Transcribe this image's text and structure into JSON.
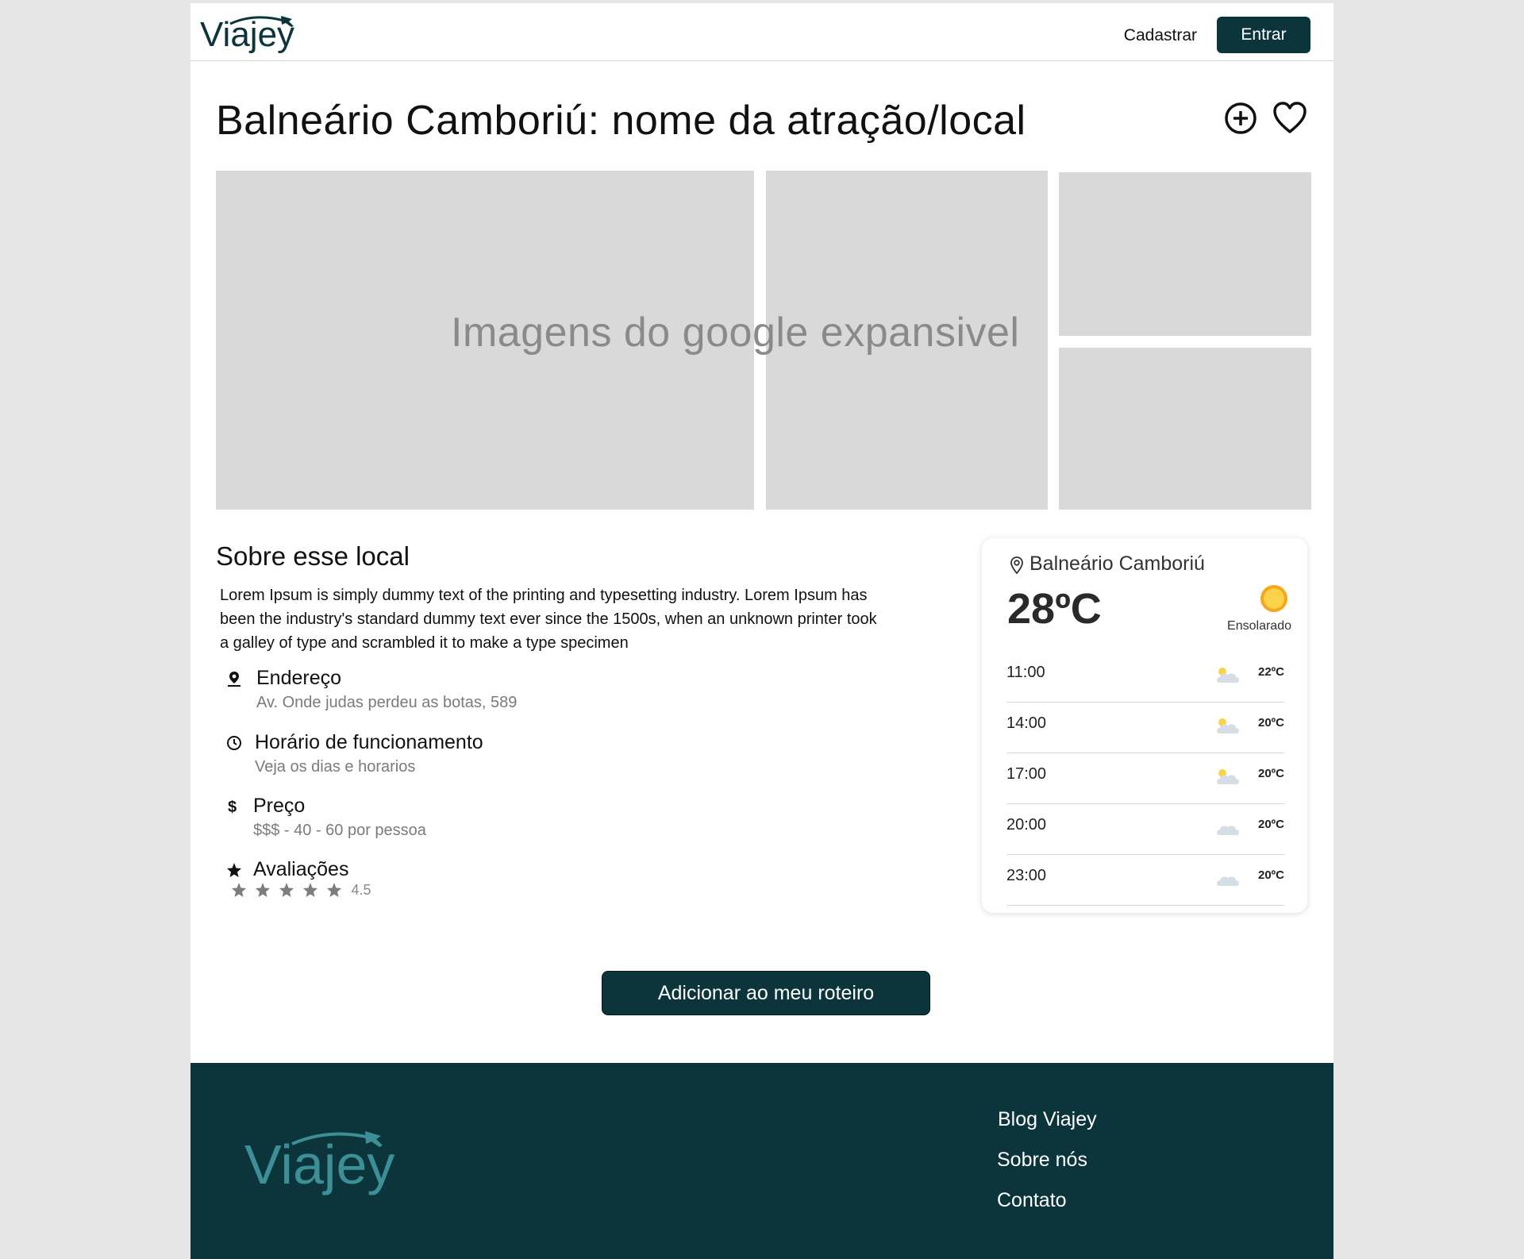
{
  "header": {
    "logo_text": "Viajey",
    "signup_label": "Cadastrar",
    "login_label": "Entrar"
  },
  "page": {
    "title": "Balneário Camboriú: nome da atração/local"
  },
  "gallery": {
    "label": "Imagens do google expansivel"
  },
  "about": {
    "title": "Sobre esse local",
    "text": "Lorem Ipsum is simply dummy text of the printing and  typesetting industry. Lorem Ipsum has been the industry's standard dummy text ever since the 1500s, when an unknown printer took a galley of  type and scrambled it to make a type specimen",
    "items": [
      {
        "icon": "map-pin-icon",
        "label": "Endereço",
        "sub": "Av. Onde judas perdeu as botas, 589"
      },
      {
        "icon": "clock-icon",
        "label": "Horário de funcionamento",
        "sub": "Veja os dias e horarios"
      },
      {
        "icon": "dollar-icon",
        "label": "Preço",
        "sub": "$$$ - 40 - 60 por pessoa"
      },
      {
        "icon": "star-icon",
        "label": "Avaliações",
        "rating": "4.5",
        "stars": 5
      }
    ]
  },
  "weather": {
    "location": "Balneário Camboriú",
    "temperature": "28ºC",
    "condition": "Ensolarado",
    "forecast": [
      {
        "time": "11:00",
        "temp": "22ºC",
        "icon": "partly-cloudy-icon"
      },
      {
        "time": "14:00",
        "temp": "20ºC",
        "icon": "partly-cloudy-icon"
      },
      {
        "time": "17:00",
        "temp": "20ºC",
        "icon": "partly-cloudy-icon"
      },
      {
        "time": "20:00",
        "temp": "20ºC",
        "icon": "cloud-icon"
      },
      {
        "time": "23:00",
        "temp": "20ºC",
        "icon": "cloud-icon"
      }
    ]
  },
  "cta": {
    "label": "Adicionar ao meu roteiro"
  },
  "footer": {
    "logo_text": "Viajey",
    "links": [
      "Blog Viajey",
      "Sobre nós",
      "Contato"
    ]
  },
  "colors": {
    "brand_dark": "#0b353b",
    "brand_teal": "#3d8f97",
    "placeholder_gray": "#d9d9d9",
    "sun": "#f7b733"
  }
}
